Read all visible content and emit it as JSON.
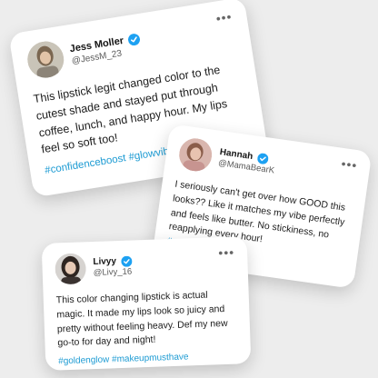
{
  "colors": {
    "background": "#ededed",
    "card": "#ffffff",
    "hashtag": "#1d9bd3",
    "verified": "#1da1f2"
  },
  "icons": {
    "verified": "verified-badge-icon",
    "more": "more-options-icon"
  },
  "posts": [
    {
      "name": "Jess Moller",
      "handle": "@JessM_23",
      "more": "•••",
      "text": "This lipstick legit changed color to the cutest shade and stayed put through coffee, lunch, and happy hour. My lips feel so soft too!",
      "tags": "#confidenceboost #glowvibes"
    },
    {
      "name": "Hannah",
      "handle": "@MamaBearK",
      "more": "•••",
      "text": "I seriously can't get over how GOOD this looks?? Like it matches my vibe perfectly and feels like butter. No stickiness, no reapplying every hour!",
      "tags": "#selflove"
    },
    {
      "name": "Livyy",
      "handle": "@Livy_16",
      "more": "•••",
      "text": "This color changing lipstick is actual magic. It made my lips look so juicy and pretty without feeling heavy. Def my new go-to for day and night!",
      "tags": "#goldenglow #makeupmusthave"
    }
  ]
}
